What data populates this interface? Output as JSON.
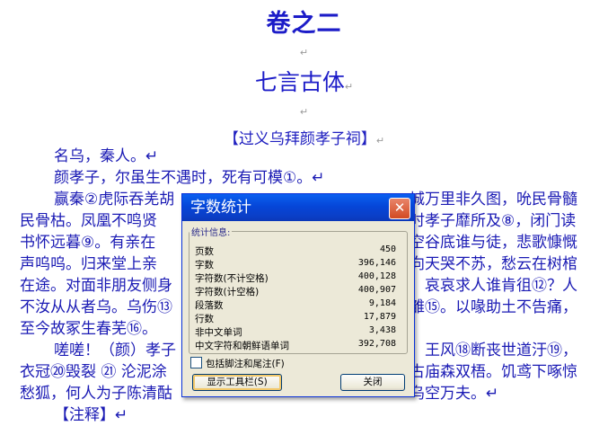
{
  "document": {
    "heading1": "卷之二",
    "heading2": "七言古体",
    "subheading": "【过义乌拜颜孝子祠】",
    "para_mark": "↵",
    "lines": [
      "名乌，秦人。↵",
      "颜孝子，尔虽生不遇时，死有可模①。↵",
      "赢秦②虎际吞羌胡",
      "城万里非久图，吮民骨髓",
      "民骨枯。凤凰不鸣贤",
      "时孝子靡所及⑧，闭门读",
      "书怀远暮⑨。有亲在",
      "空谷底谁与徒，悲歌慷慨",
      "声呜呜。归来堂上亲",
      "向天哭不苏，愁云在树棺",
      "在途。对面非朋友侧身",
      "。哀哀求人谁肯徂⑫？人",
      "不汝从从者乌。乌伤⑬",
      "雏⑮。以喙助土不告痛，",
      "至今故冢生春芜⑯。",
      "嗟嗟！（颜）孝子",
      "。王风⑱断丧世道汙⑲，",
      "衣冠⑳毁裂 ㉑ 沦泥涂",
      "古庙森双梧。饥鸢下啄惊",
      "愁狐，何人为子陈清酤",
      "乌空万夫。↵",
      "【注释】↵"
    ]
  },
  "dialog": {
    "title": "字数统计",
    "group_label": "统计信息:",
    "stats": [
      {
        "label": "页数",
        "value": "450"
      },
      {
        "label": "字数",
        "value": "396,146"
      },
      {
        "label": "字符数(不计空格)",
        "value": "400,128"
      },
      {
        "label": "字符数(计空格)",
        "value": "400,907"
      },
      {
        "label": "段落数",
        "value": "9,184"
      },
      {
        "label": "行数",
        "value": "17,879"
      },
      {
        "label": "非中文单词",
        "value": "3,438"
      },
      {
        "label": "中文字符和朝鲜语单词",
        "value": "392,708"
      }
    ],
    "checkbox_label": "包括脚注和尾注(F)",
    "toolbar_button": "显示工具栏(S)",
    "close_button": "关闭"
  }
}
